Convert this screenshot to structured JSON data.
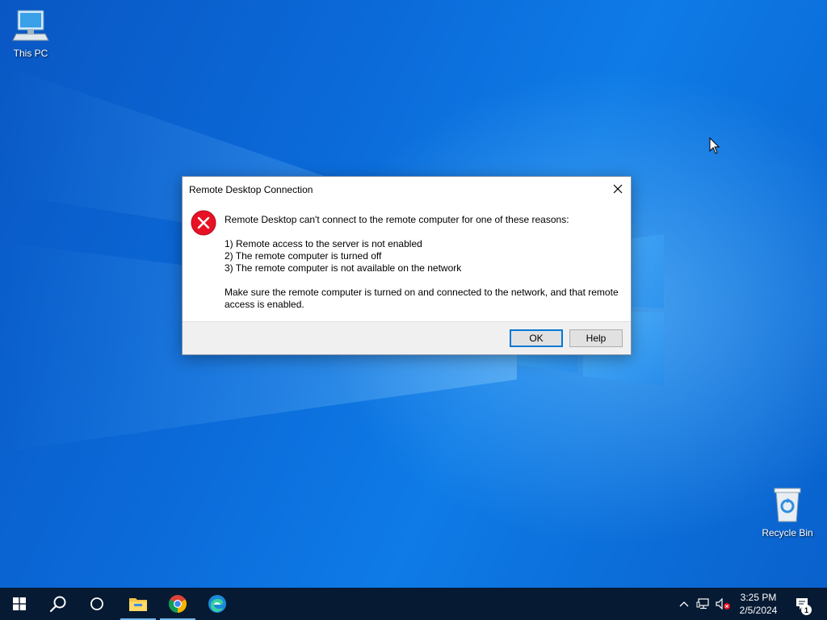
{
  "desktop": {
    "icons": [
      {
        "label": "This PC",
        "icon": "computer-icon"
      },
      {
        "label": "Recycle Bin",
        "icon": "recycle-bin-icon"
      }
    ]
  },
  "dialog": {
    "title": "Remote Desktop Connection",
    "icon": "error-icon",
    "message": "Remote Desktop can't connect to the remote computer for one of these reasons:",
    "reasons": [
      "1) Remote access to the server is not enabled",
      "2) The remote computer is turned off",
      "3) The remote computer is not available on the network"
    ],
    "advice": "Make sure the remote computer is turned on and connected to the network, and that remote access is enabled.",
    "buttons": {
      "ok": "OK",
      "help": "Help"
    }
  },
  "taskbar": {
    "pinned": [
      "start-icon",
      "search-icon",
      "task-view-icon",
      "file-explorer-icon",
      "chrome-icon",
      "edge-icon"
    ],
    "tray": {
      "time": "3:25 PM",
      "date": "2/5/2024",
      "notification_count": "1"
    }
  },
  "colors": {
    "accent": "#0078d7",
    "error_red": "#e81123",
    "taskbar": "#061a33",
    "wallpaper": "#0b6ad8"
  }
}
